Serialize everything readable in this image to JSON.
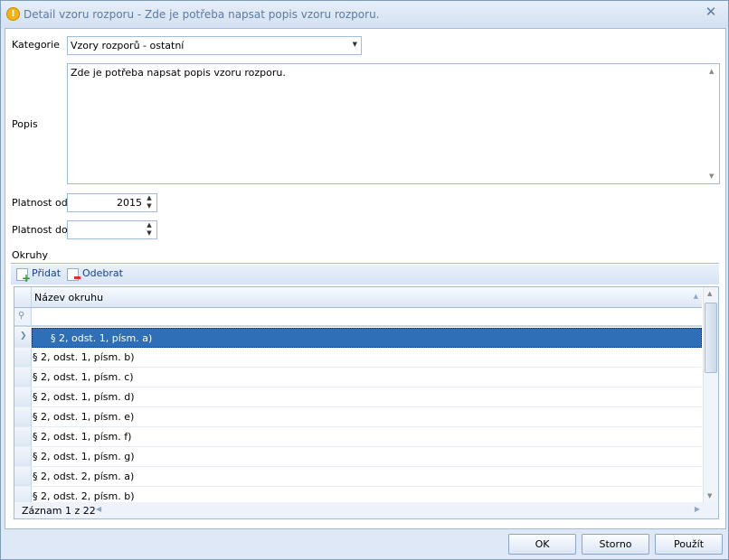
{
  "window": {
    "title": "Detail vzoru rozporu - Zde je potřeba napsat popis vzoru rozporu.",
    "icon": "warning-icon",
    "close_glyph": "✕"
  },
  "form": {
    "category_label": "Kategorie",
    "category_value": "Vzory rozporů - ostatní",
    "description_label": "Popis",
    "description_value": "Zde je potřeba napsat popis vzoru rozporu.",
    "valid_from_label": "Platnost od",
    "valid_from_value": "2015",
    "valid_to_label": "Platnost do",
    "valid_to_value": "",
    "areas_label": "Okruhy"
  },
  "toolbar": {
    "add_label": "Přidat",
    "remove_label": "Odebrat"
  },
  "grid": {
    "column_header": "Název okruhu",
    "filter_value": "",
    "rows": [
      "§ 2, odst. 1, písm. a)",
      "§ 2, odst. 1, písm. b)",
      "§ 2, odst. 1, písm. c)",
      "§ 2, odst. 1, písm. d)",
      "§ 2, odst. 1, písm. e)",
      "§ 2, odst. 1, písm. f)",
      "§ 2, odst. 1, písm. g)",
      "§ 2, odst. 2, písm. a)",
      "§ 2, odst. 2, písm. b)"
    ],
    "selected_index": 0,
    "record_status": "Záznam 1 z 22"
  },
  "buttons": {
    "ok": "OK",
    "cancel": "Storno",
    "apply": "Použít"
  },
  "colors": {
    "selection": "#2f6fb7",
    "accent": "#15428b",
    "border": "#a3bbd9"
  }
}
